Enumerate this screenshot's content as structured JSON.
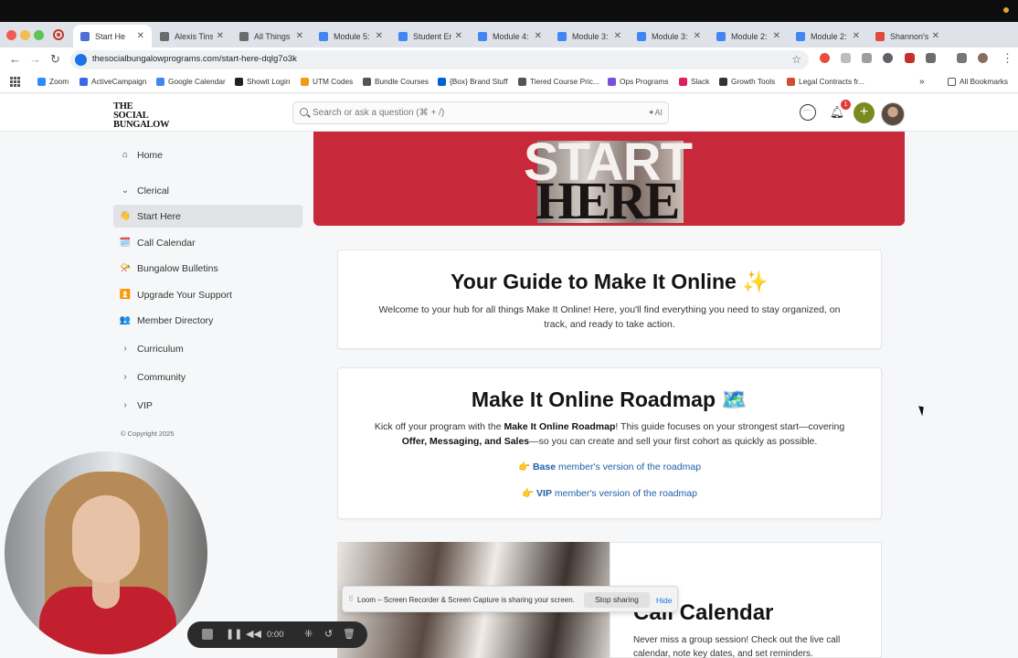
{
  "browser": {
    "tabs": [
      {
        "label": "Start He",
        "color": "#4d6fd1",
        "active": true
      },
      {
        "label": "Alexis Tins",
        "color": "#6b6b6b"
      },
      {
        "label": "All Things V",
        "color": "#6b6b6b"
      },
      {
        "label": "Module 5:",
        "color": "#4285f4"
      },
      {
        "label": "Student En",
        "color": "#4285f4"
      },
      {
        "label": "Module 4:",
        "color": "#4285f4"
      },
      {
        "label": "Module 3:",
        "color": "#4285f4"
      },
      {
        "label": "Module 3:",
        "color": "#4285f4"
      },
      {
        "label": "Module 2:",
        "color": "#4285f4"
      },
      {
        "label": "Module 2:",
        "color": "#4285f4"
      },
      {
        "label": "Shannon's",
        "color": "#e04a3a"
      }
    ],
    "url": "thesocialbungalowprograms.com/start-here-dqlg7o3k",
    "bookmarks": [
      {
        "label": "Zoom",
        "color": "#2d8cff"
      },
      {
        "label": "ActiveCampaign",
        "color": "#356ae6"
      },
      {
        "label": "Google Calendar",
        "color": "#4285f4"
      },
      {
        "label": "Showit Login",
        "color": "#222222"
      },
      {
        "label": "UTM Codes",
        "color": "#f09a1a"
      },
      {
        "label": "Bundle Courses",
        "color": "#555555"
      },
      {
        "label": "{Box} Brand Stuff",
        "color": "#0061d5"
      },
      {
        "label": "Tiered Course Pric...",
        "color": "#555555"
      },
      {
        "label": "Ops Programs",
        "color": "#7b4fd6"
      },
      {
        "label": "Slack",
        "color": "#e01e5a"
      },
      {
        "label": "Growth Tools",
        "color": "#333333"
      },
      {
        "label": "Legal Contracts fr...",
        "color": "#d24d2c"
      }
    ],
    "all_bookmarks": "All Bookmarks"
  },
  "header": {
    "logo": "THE SOCIAL BUNGALOW",
    "search_placeholder": "Search or ask a question (⌘ + /)",
    "ai_label": "✦AI",
    "notification_count": "1"
  },
  "sidebar": {
    "items": [
      {
        "label": "Home",
        "icon": "home-icon"
      },
      {
        "label": "Clerical",
        "icon": "chevron-down-icon"
      },
      {
        "label": "Start Here",
        "icon": "👋"
      },
      {
        "label": "Call Calendar",
        "icon": "🗓️"
      },
      {
        "label": "Bungalow Bulletins",
        "icon": "📯"
      },
      {
        "label": "Upgrade Your Support",
        "icon": "⏫"
      },
      {
        "label": "Member Directory",
        "icon": "👥"
      },
      {
        "label": "Curriculum",
        "icon": "chevron-right-icon"
      },
      {
        "label": "Community",
        "icon": "chevron-right-icon"
      },
      {
        "label": "VIP",
        "icon": "chevron-right-icon"
      }
    ],
    "copyright": "© Copyright 2025"
  },
  "banner": {
    "line1": "START",
    "line2": "HERE"
  },
  "guide": {
    "title": "Your Guide to Make It Online ✨",
    "body": "Welcome to your hub for all things Make It Online! Here, you'll find everything you need to stay organized, on track, and ready to take action."
  },
  "roadmap": {
    "title": "Make It Online Roadmap 🗺️",
    "intro_pre": "Kick off your program with the ",
    "intro_bold": "Make It Online Roadmap",
    "intro_mid": "! This guide focuses on your strongest start—covering ",
    "intro_bold2": "Offer, Messaging, and Sales",
    "intro_post": "—so you can create and sell your first cohort as quickly as possible.",
    "link1_pointer": "👉 ",
    "link1_bold": "Base",
    "link1_text": " member's version of the roadmap",
    "link2_pointer": "👉 ",
    "link2_bold": "VIP",
    "link2_text": " member's version of the roadmap"
  },
  "calendar": {
    "title": "Call Calendar",
    "body": "Never miss a group session! Check out the live call calendar, note key dates, and set reminders."
  },
  "loom": {
    "share_message": "Loom – Screen Recorder & Screen Capture is sharing your screen.",
    "stop_sharing": "Stop sharing",
    "hide": "Hide",
    "time": "0:00"
  }
}
